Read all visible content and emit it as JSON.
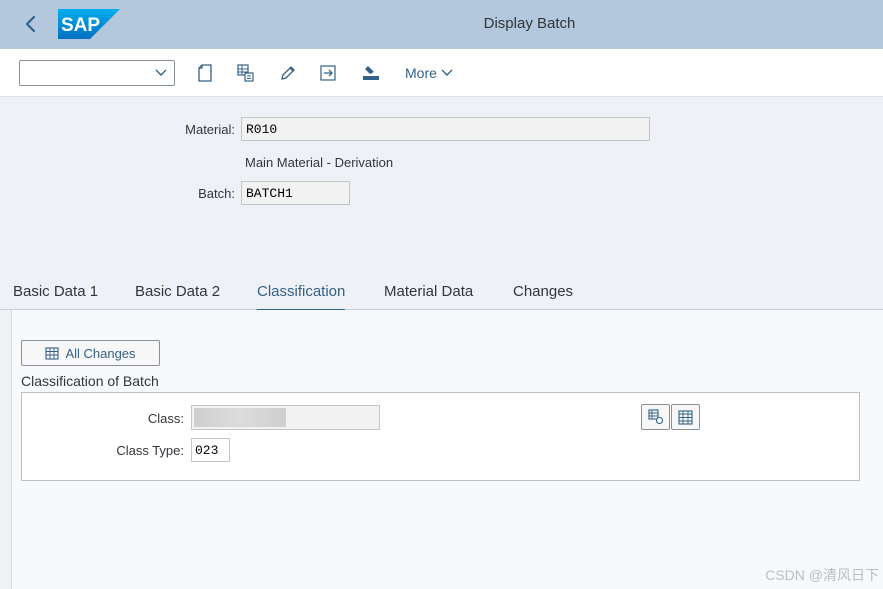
{
  "header": {
    "title": "Display Batch",
    "logo_text": "SAP",
    "back_icon": "chevron-left-icon",
    "brand_color": "#0a6ed1"
  },
  "toolbar": {
    "select_value": "",
    "icons": [
      "document-icon",
      "table-settings-icon",
      "pencil-icon",
      "export-icon",
      "upload-icon"
    ],
    "more_label": "More"
  },
  "form": {
    "material_label": "Material:",
    "material_value": "R010",
    "material_desc": "Main Material - Derivation",
    "batch_label": "Batch:",
    "batch_value": "BATCH1"
  },
  "tabs": [
    {
      "label": "Basic Data 1",
      "active": false
    },
    {
      "label": "Basic Data 2",
      "active": false
    },
    {
      "label": "Classification",
      "active": true
    },
    {
      "label": "Material Data",
      "active": false
    },
    {
      "label": "Changes",
      "active": false
    }
  ],
  "classification": {
    "all_changes_label": "All Changes",
    "section_title": "Classification of Batch",
    "class_label": "Class:",
    "class_value": "",
    "class_type_label": "Class Type:",
    "class_type_value": "023"
  },
  "watermark": "CSDN @清风日下"
}
